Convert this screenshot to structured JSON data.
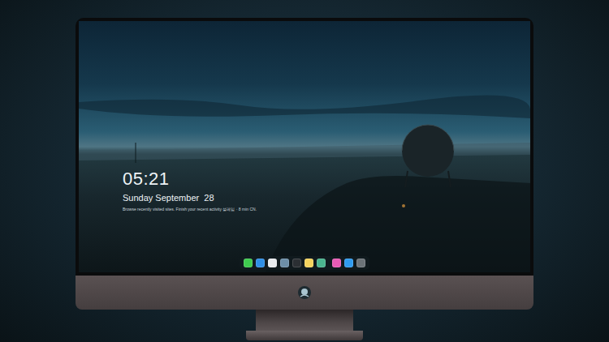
{
  "lock_screen": {
    "time": "05:21",
    "date": "Sunday September  28",
    "status": "Browse recently visited sites. Finish your recent activity 설레임 · 8 min CN."
  },
  "dock": {
    "apps": [
      {
        "color": "#3fcb4f"
      },
      {
        "color": "#2f8fe6"
      },
      {
        "color": "#e9ecef"
      },
      {
        "color": "#6d8fa8"
      },
      {
        "color": "#2b2f33"
      },
      {
        "color": "#f4d35e"
      },
      {
        "color": "#4bb58f"
      }
    ],
    "recent": [
      {
        "color": "#e85bb5"
      },
      {
        "color": "#2f9cf0"
      },
      {
        "color": "#6c7378"
      }
    ]
  }
}
